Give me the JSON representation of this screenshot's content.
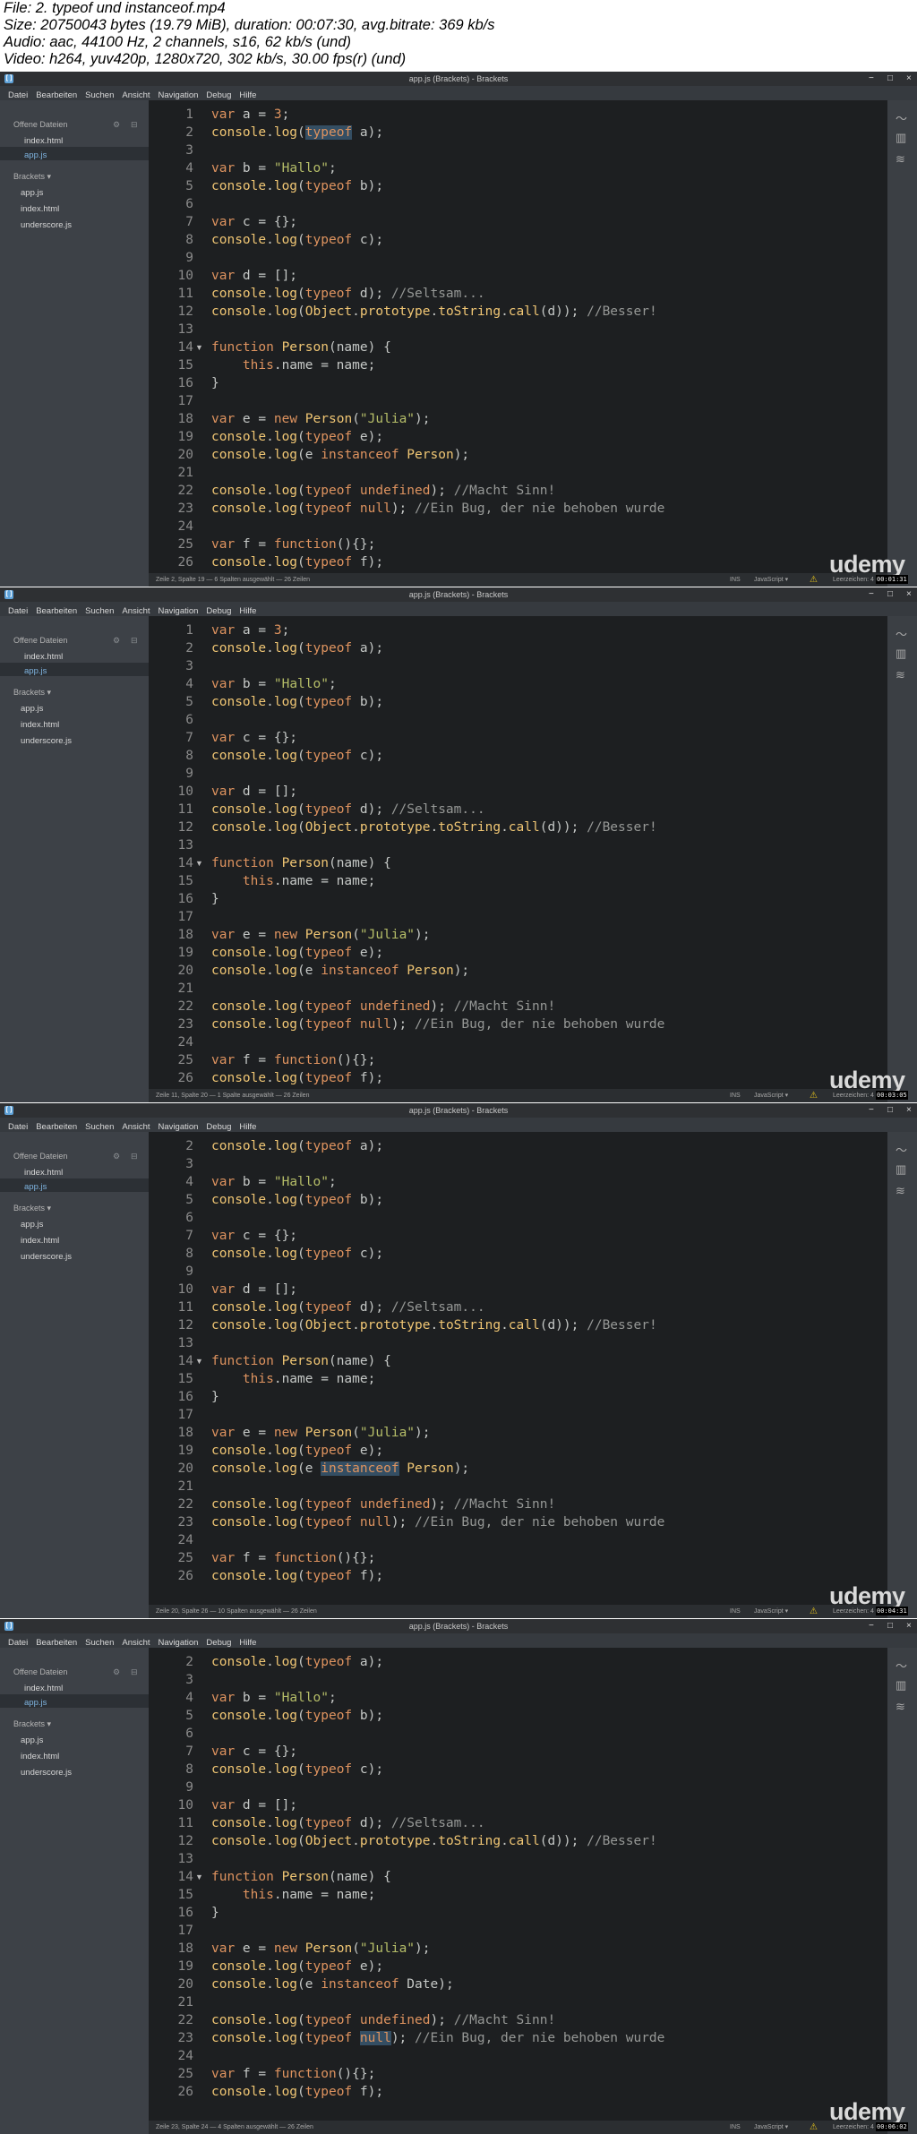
{
  "header": {
    "line1": "File: 2. typeof und instanceof.mp4",
    "line2": "Size: 20750043 bytes (19.79 MiB), duration: 00:07:30, avg.bitrate: 369 kb/s",
    "line3": "Audio: aac, 44100 Hz, 2 channels, s16, 62 kb/s (und)",
    "line4": "Video: h264, yuv420p, 1280x720, 302 kb/s, 30.00 fps(r) (und)"
  },
  "app": {
    "title": "app.js (Brackets) - Brackets",
    "menu": [
      "Datei",
      "Bearbeiten",
      "Suchen",
      "Ansicht",
      "Navigation",
      "Debug",
      "Hilfe"
    ],
    "open_files_title": "Offene Dateien",
    "open_files": [
      "index.html",
      "app.js"
    ],
    "project_title": "Brackets ▾",
    "project_files": [
      "app.js",
      "index.html",
      "underscore.js"
    ],
    "ins": "INS",
    "language": "JavaScript ▾",
    "spaces": "Leerzeichen: 4",
    "watermark": "udemy",
    "icons": [
      "brackets-logo-icon",
      "live-preview-icon",
      "extension-manager-icon",
      "layers-icon",
      "warning-icon"
    ],
    "accent_color": "#de935f"
  },
  "frames": [
    {
      "first_line": 1,
      "status": "Zeile 2, Spalte 19 — 6 Spalten ausgewählt — 26 Zeilen",
      "timestamp": "00:01:31",
      "thumb_pos": 0.0,
      "thumb_len": 0.9
    },
    {
      "first_line": 1,
      "status": "Zeile 11, Spalte 20 — 1 Spalte ausgewählt — 26 Zeilen",
      "timestamp": "00:03:05",
      "thumb_pos": 0.0,
      "thumb_len": 0.9
    },
    {
      "first_line": 2,
      "status": "Zeile 20, Spalte 26 — 10 Spalten ausgewählt — 26 Zeilen",
      "timestamp": "00:04:31",
      "thumb_pos": 0.08,
      "thumb_len": 0.9
    },
    {
      "first_line": 2,
      "status": "Zeile 23, Spalte 24 — 4 Spalten ausgewählt — 26 Zeilen",
      "timestamp": "00:06:02",
      "thumb_pos": 0.08,
      "thumb_len": 0.9
    }
  ],
  "code_lines": [
    "var a = 3;",
    "console.log(typeof a);",
    "",
    "var b = \"Hallo\";",
    "console.log(typeof b);",
    "",
    "var c = {};",
    "console.log(typeof c);",
    "",
    "var d = [];",
    "console.log(typeof d); //Seltsam...",
    "console.log(Object.prototype.toString.call(d)); //Besser!",
    "",
    "function Person(name) {",
    "    this.name = name;",
    "}",
    "",
    "var e = new Person(\"Julia\");",
    "console.log(typeof e);",
    "console.log(e instanceof Person);",
    "",
    "console.log(typeof undefined); //Macht Sinn!",
    "console.log(typeof null); //Ein Bug, der nie behoben wurde",
    "",
    "var f = function(){};",
    "console.log(typeof f);"
  ],
  "frame4_line20": "console.log(e instanceof Date);"
}
